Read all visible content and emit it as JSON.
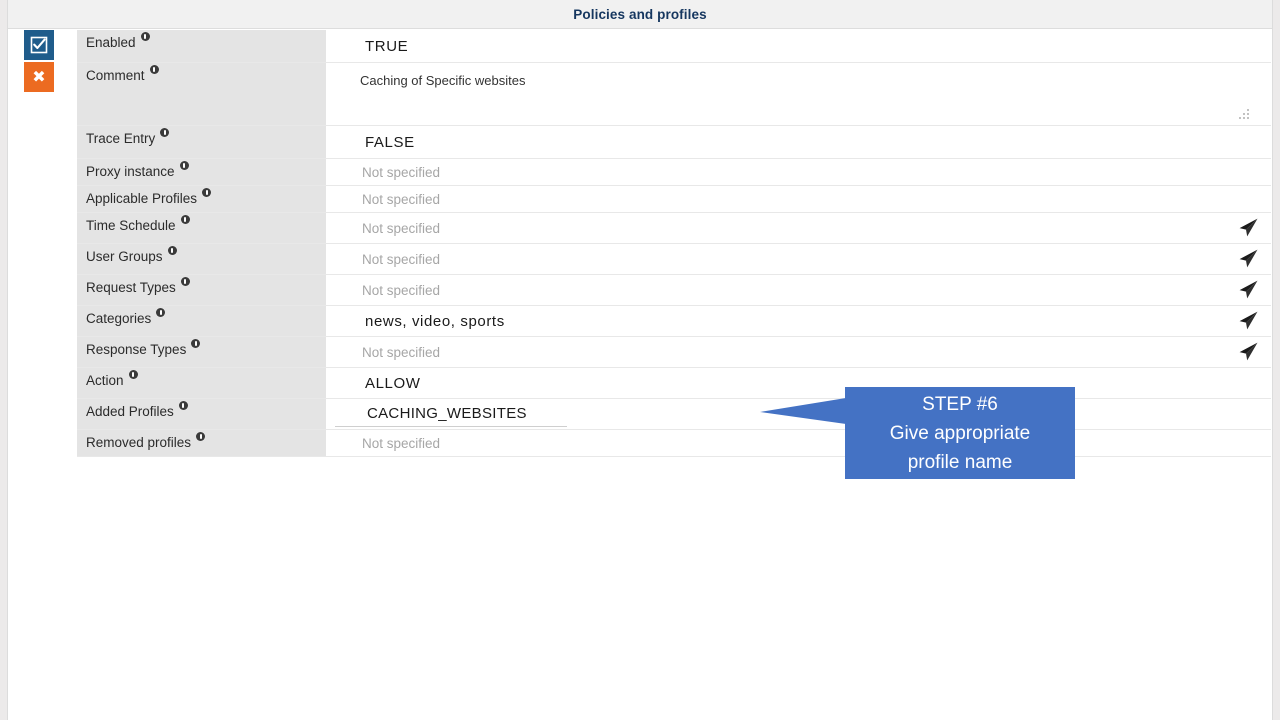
{
  "window": {
    "title": "Policies and profiles"
  },
  "colors": {
    "titlebar_bg": "#f1f1f1",
    "title_text": "#15365f",
    "label_bg": "#e4e4e4",
    "enable_button": "#1f5c8b",
    "delete_button": "#ec6b21",
    "callout_bg": "#4472c4",
    "placeholder_text": "#a6a6a6"
  },
  "rail": {
    "enable_icon": "checkbox-checked-icon",
    "delete_icon": "close-x-icon",
    "delete_glyph": "✖"
  },
  "placeholders": {
    "not_specified": "Not specified"
  },
  "fields": [
    {
      "label": "Enabled",
      "value": "TRUE",
      "kind": "value",
      "info_icon": "info-icon",
      "has_send": false
    },
    {
      "label": "Comment",
      "value": "Caching of Specific websites",
      "kind": "textarea",
      "info_icon": "info-icon",
      "has_send": false
    },
    {
      "label": "Trace Entry",
      "value": "FALSE",
      "kind": "value",
      "info_icon": "info-icon",
      "has_send": false
    },
    {
      "label": "Proxy instance",
      "value": "Not specified",
      "kind": "placeholder",
      "info_icon": "info-icon",
      "has_send": false
    },
    {
      "label": "Applicable Profiles",
      "value": "Not specified",
      "kind": "placeholder",
      "info_icon": "info-icon",
      "has_send": false
    },
    {
      "label": "Time Schedule",
      "value": "Not specified",
      "kind": "placeholder",
      "info_icon": "info-icon",
      "has_send": true
    },
    {
      "label": "User Groups",
      "value": "Not specified",
      "kind": "placeholder",
      "info_icon": "info-icon",
      "has_send": true
    },
    {
      "label": "Request Types",
      "value": "Not specified",
      "kind": "placeholder",
      "info_icon": "info-icon",
      "has_send": true
    },
    {
      "label": "Categories",
      "value": "news,  video,  sports",
      "kind": "value",
      "info_icon": "info-icon",
      "has_send": true
    },
    {
      "label": "Response Types",
      "value": "Not specified",
      "kind": "placeholder",
      "info_icon": "info-icon",
      "has_send": true
    },
    {
      "label": "Action",
      "value": "ALLOW",
      "kind": "value",
      "info_icon": "info-icon",
      "has_send": false
    },
    {
      "label": "Added Profiles",
      "value": "CACHING_WEBSITES",
      "kind": "input",
      "info_icon": "info-icon",
      "has_send": false
    },
    {
      "label": "Removed profiles",
      "value": "Not specified",
      "kind": "placeholder",
      "info_icon": "info-icon",
      "has_send": false
    }
  ],
  "callout": {
    "line1": "STEP #6",
    "line2": "Give appropriate",
    "line3": "profile name"
  }
}
